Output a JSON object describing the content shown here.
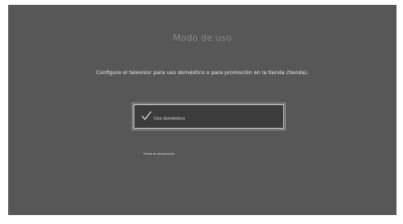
{
  "screen": {
    "title": "Modo de uso",
    "description": "Configure el televisor para uso doméstico o para promoción en la tienda (tienda).",
    "options": [
      {
        "label": "Uso doméstico",
        "selected": true
      },
      {
        "label": "Tienda de demostración",
        "selected": false
      }
    ]
  },
  "colors": {
    "background": "#575757",
    "selected_option_fill": "#3c3c3c",
    "selected_option_border": "#d8d8d8"
  },
  "icons": {
    "selected_marker": "checkmark-icon"
  }
}
